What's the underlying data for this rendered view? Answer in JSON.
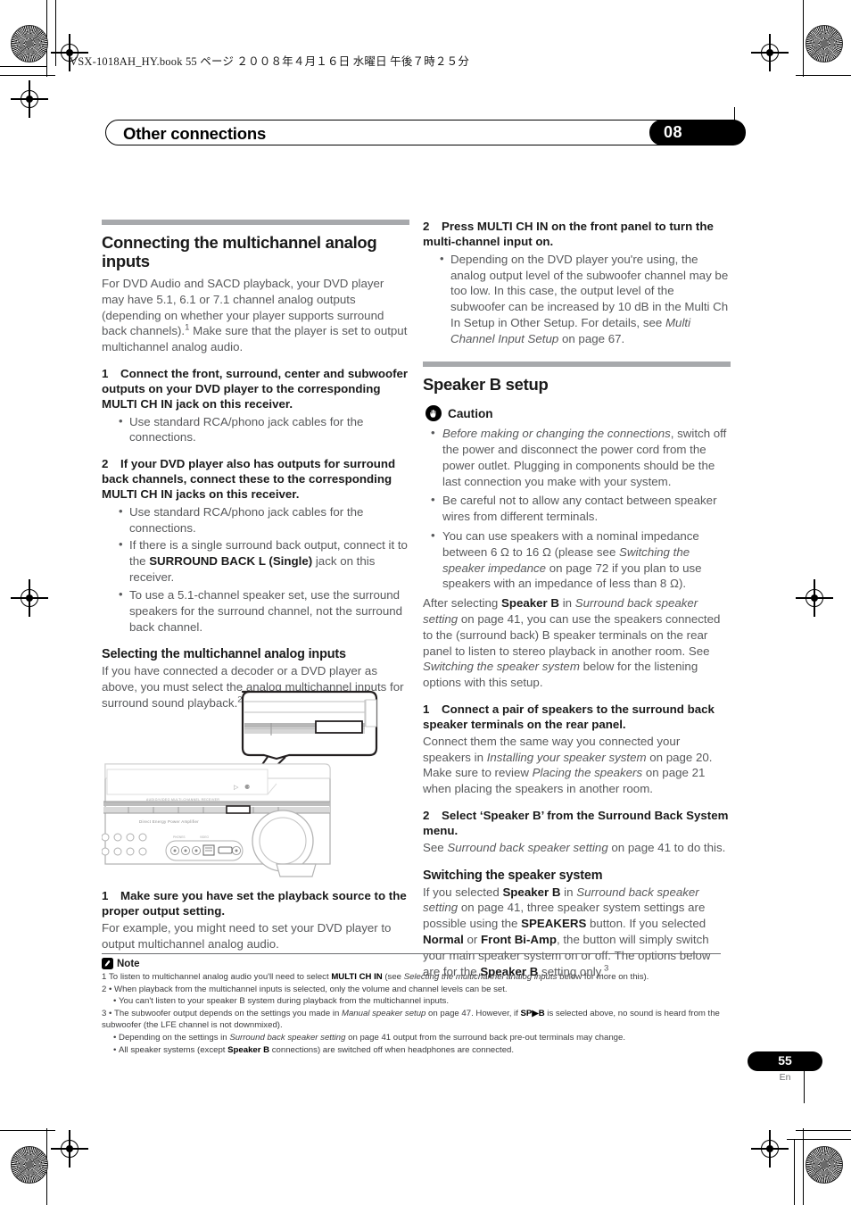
{
  "print": {
    "book_header": "VSX-1018AH_HY.book   55 ページ   ２００８年４月１６日   水曜日   午後７時２５分"
  },
  "chapter": {
    "title": "Other connections",
    "number": "08"
  },
  "left_column": {
    "section1": {
      "heading": "Connecting the multichannel analog inputs",
      "intro_part1": "For DVD Audio and SACD playback, your DVD player may have 5.1, 6.1 or 7.1 channel analog outputs (depending on whether your player supports surround back channels).",
      "intro_footnote": "1",
      "intro_part2": " Make sure that the player is set to output multichannel analog audio.",
      "step1_num": "1",
      "step1_text": "Connect the front, surround, center and subwoofer outputs on your DVD player to the corresponding MULTI CH IN jack on this receiver.",
      "step1_bullets": [
        "Use standard RCA/phono jack cables for the connections."
      ],
      "step2_num": "2",
      "step2_text": "If your DVD player also has outputs for surround back channels, connect these to the corresponding MULTI CH IN jacks on this receiver.",
      "step2_bullet1": "Use standard RCA/phono jack cables for the connections.",
      "step2_bullet2_a": "If there is a single surround back output, connect it to the ",
      "step2_bullet2_b": "SURROUND BACK L (Single)",
      "step2_bullet2_c": " jack on this receiver.",
      "step2_bullet3": "To use a 5.1-channel speaker set, use the surround speakers for the surround channel, not the surround back channel."
    },
    "section2": {
      "heading": "Selecting the multichannel analog inputs",
      "intro_part1": "If you have connected a decoder or a DVD player as above, you must select the analog multichannel inputs for surround sound playback.",
      "intro_footnote": "2",
      "step1_num": "1",
      "step1_text": "Make sure you have set the playback source to the proper output setting.",
      "step1_body": "For example, you might need to set your DVD player to output multichannel analog audio."
    },
    "illustration": {
      "alt": "Receiver front panel with callout showing MULTI CH IN button"
    }
  },
  "right_column": {
    "section1_cont": {
      "step2_num": "2",
      "step2_text": "Press MULTI CH IN on the front panel to turn the multi-channel input on.",
      "step2_bullet_a": "Depending on the DVD player you're using, the analog output level of the subwoofer channel may be too low. In this case, the output level of the subwoofer can be increased by 10 dB in the Multi Ch In Setup in Other Setup. For details, see ",
      "step2_bullet_b": "Multi Channel Input Setup",
      "step2_bullet_c": " on page 67."
    },
    "section2": {
      "heading": "Speaker B setup",
      "caution_label": "Caution",
      "caution_icon": "hand-palm-icon",
      "caution_b1_i": "Before making or changing the connections",
      "caution_b1_rest": ", switch off the power and disconnect the power cord from the power outlet. Plugging in components should be the last connection you make with your system.",
      "caution_b2": "Be careful not to allow any contact between speaker wires from different terminals.",
      "caution_b3_a": "You can use speakers with a nominal impedance between 6 Ω to 16 Ω (please see ",
      "caution_b3_i": "Switching the speaker impedance",
      "caution_b3_b": " on page 72 if you plan to use speakers with an impedance of less than 8 Ω).",
      "after_a": "After selecting ",
      "after_b": "Speaker B",
      "after_c": " in ",
      "after_i": "Surround back speaker setting",
      "after_d": " on page 41, you can use the speakers connected to the (surround back) B speaker terminals on the rear panel to listen to stereo playback in another room. See ",
      "after_i2": "Switching the speaker system",
      "after_e": " below for the listening options with this setup.",
      "step1_num": "1",
      "step1_text": "Connect a pair of speakers to the surround back speaker terminals on the rear panel.",
      "step1_body_a": "Connect them the same way you connected your speakers in ",
      "step1_body_i1": "Installing your speaker system",
      "step1_body_b": " on page 20. Make sure to review ",
      "step1_body_i2": "Placing the speakers",
      "step1_body_c": " on page 21 when placing the speakers in another room.",
      "step2_num": "2",
      "step2_text": "Select ‘Speaker B’ from the Surround Back System menu.",
      "step2_body_a": "See ",
      "step2_body_i": "Surround back speaker setting",
      "step2_body_b": " on page 41 to do this."
    },
    "section3": {
      "heading": "Switching the speaker system",
      "body_a": "If you selected ",
      "body_b1": "Speaker B",
      "body_c": " in ",
      "body_i": "Surround back speaker setting",
      "body_d": " on page 41, three speaker system settings are possible using the ",
      "body_b2": "SPEAKERS",
      "body_e": " button. If you selected ",
      "body_b3": "Normal",
      "body_f": " or ",
      "body_b4": "Front Bi-Amp",
      "body_g": ", the button will simply switch your main speaker system on or off. The options below are for the ",
      "body_b5": "Speaker B",
      "body_h": " setting only.",
      "body_footnote": "3"
    }
  },
  "notes": {
    "label": "Note",
    "icon": "note-pencil-icon",
    "n1_num": "1",
    "n1_a": "To listen to multichannel analog audio you'll need to select ",
    "n1_b": "MULTI CH IN",
    "n1_c": " (see ",
    "n1_i": "Selecting the multichannel analog inputs",
    "n1_d": " below for more on this).",
    "n2_num": "2",
    "n2_b1": "When playback from the multichannel inputs is selected, only the volume and channel levels can be set.",
    "n2_b2": "You can't listen to your speaker B system during playback from the multichannel inputs.",
    "n3_num": "3",
    "n3_a": "The subwoofer output depends on the settings you made in ",
    "n3_i": "Manual speaker setup",
    "n3_b": " on page 47. However, if ",
    "n3_sp": "SP▶B",
    "n3_c": " is selected above, no sound is heard from the subwoofer (the LFE channel is not downmixed).",
    "n3_b2_a": "Depending on the settings in ",
    "n3_b2_i": "Surround back speaker setting",
    "n3_b2_b": " on page 41 output from the surround back pre-out terminals may change.",
    "n3_b3_a": "All speaker systems (except ",
    "n3_b3_b": "Speaker B",
    "n3_b3_c": " connections) are switched off when headphones are connected."
  },
  "footer": {
    "page_number": "55",
    "language": "En"
  },
  "colors": {
    "rule_gray": "#a7a9ac",
    "body_gray": "#58595b",
    "ink_black": "#1a1a1a"
  }
}
